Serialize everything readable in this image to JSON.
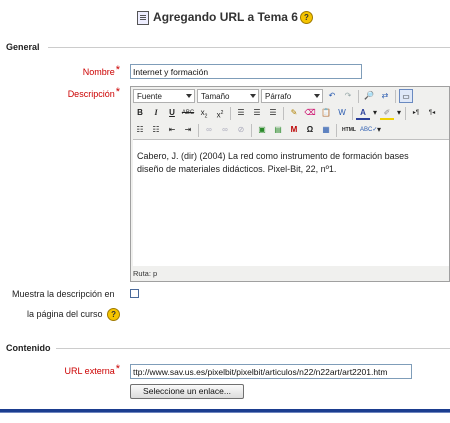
{
  "page_title": "Agregando URL a Tema 6",
  "sections": {
    "general": "General",
    "content": "Contenido"
  },
  "fields": {
    "nombre_label": "Nombre",
    "nombre_value": "Internet y formación",
    "descripcion_label": "Descripción",
    "muestra_label_1": "Muestra la descripción en",
    "muestra_label_2": "la página del curso",
    "url_label": "URL externa",
    "url_value": "ttp://www.sav.us.es/pixelbit/pixelbit/articulos/n22/n22art/art2201.htm",
    "choose_link_button": "Seleccione un enlace..."
  },
  "editor": {
    "font_select": "Fuente",
    "size_select": "Tamaño",
    "format_select": "Párrafo",
    "content_line_1": "Cabero, J. (dir) (2004) La red como instrumento de formación bases",
    "content_line_2": "diseño de materiales didácticos. Pixel-Bit, 22, nº1.",
    "status_path": "Ruta: p"
  },
  "colors": {
    "required_label": "#cc0000",
    "bottom_bar": "#1b3d8f"
  }
}
